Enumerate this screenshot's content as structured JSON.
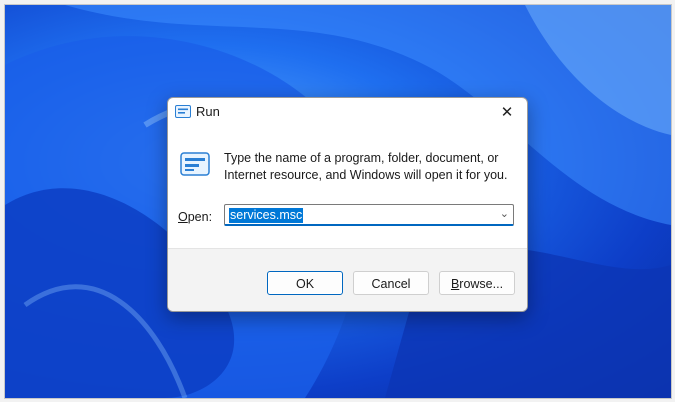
{
  "dialog": {
    "title": "Run",
    "close_symbol": "✕",
    "description": "Type the name of a program, folder, document, or Internet resource, and Windows will open it for you.",
    "open_label_prefix": "O",
    "open_label_rest": "pen:",
    "open_value": "services.msc",
    "dropdown_arrow": "⌄",
    "buttons": {
      "ok": "OK",
      "cancel": "Cancel",
      "browse_prefix": "B",
      "browse_rest": "rowse..."
    }
  },
  "icons": {
    "title": "run-app-icon",
    "body": "run-app-large-icon",
    "close": "close-icon",
    "dropdown": "chevron-down-icon"
  },
  "colors": {
    "accent": "#0067c0",
    "selection": "#0078d7",
    "wallpaper": "#1f6ff0"
  }
}
